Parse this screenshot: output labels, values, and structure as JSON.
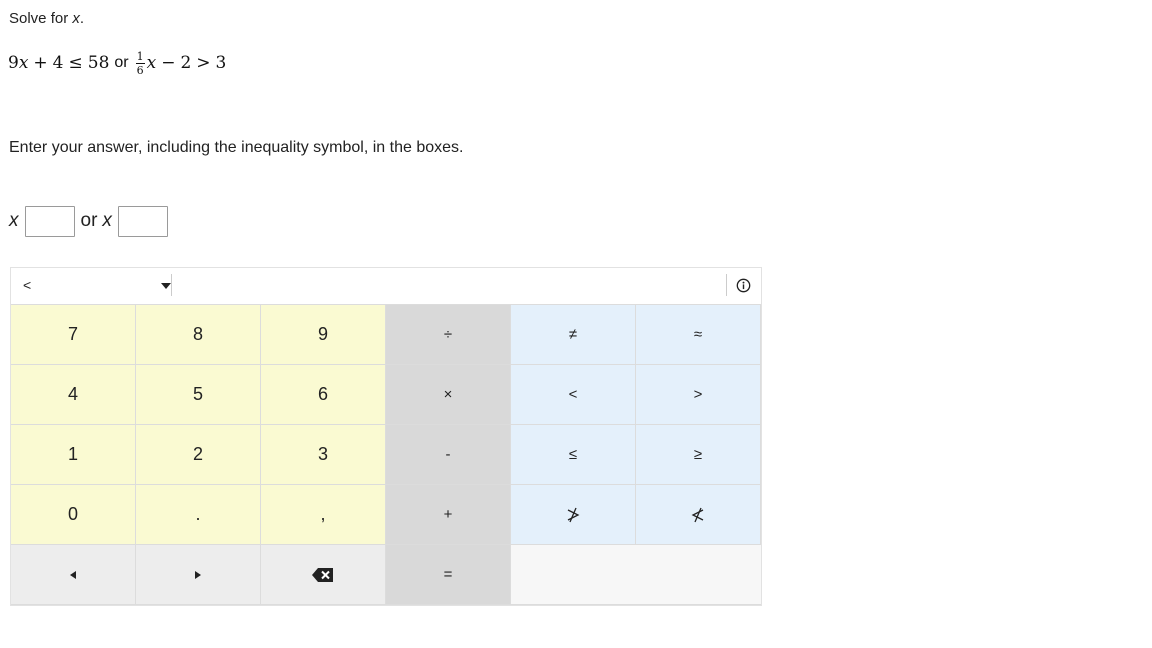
{
  "question": {
    "prompt_text": "Solve for ",
    "prompt_var": "x",
    "prompt_end": "."
  },
  "equation": {
    "left": {
      "coef": "9",
      "var": "x",
      "op1": "+",
      "const": "4",
      "rel": "≤",
      "rhs": "58"
    },
    "connector": "or",
    "right": {
      "frac_num": "1",
      "frac_den": "6",
      "var": "x",
      "op1": "−",
      "const": "2",
      "rel": ">",
      "rhs": "3"
    }
  },
  "instructions": "Enter your answer, including the inequality symbol, in the boxes.",
  "answer": {
    "var1": "x",
    "connector": "or",
    "var2": "x",
    "box1_value": "",
    "box2_value": ""
  },
  "keypad": {
    "mode_selected": "<",
    "keys": {
      "k7": "7",
      "k8": "8",
      "k9": "9",
      "divide": "÷",
      "not_equal": "≠",
      "approx": "≈",
      "k4": "4",
      "k5": "5",
      "k6": "6",
      "times": "×",
      "less": "<",
      "greater": ">",
      "k1": "1",
      "k2": "2",
      "k3": "3",
      "minus": "-",
      "leq": "≤",
      "geq": "≥",
      "k0": "0",
      "dot": ".",
      "comma": ",",
      "plus": "+",
      "equals": "="
    },
    "icons": {
      "not_greater": "not-greater-icon",
      "not_less": "not-less-icon",
      "left_arrow": "left-arrow-icon",
      "right_arrow": "right-arrow-icon",
      "backspace": "backspace-icon",
      "info": "info-icon",
      "dropdown": "chevron-down-icon"
    }
  }
}
